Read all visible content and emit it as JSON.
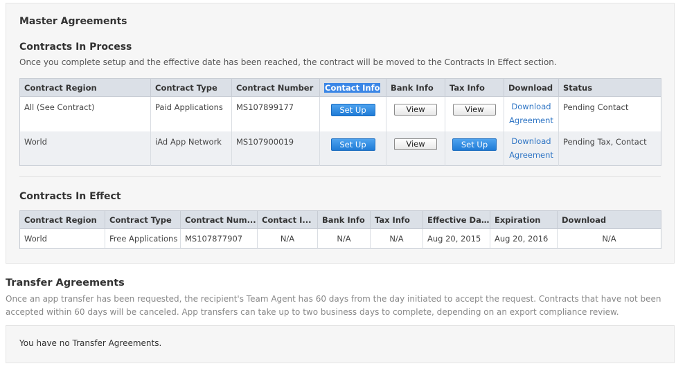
{
  "master": {
    "title": "Master Agreements",
    "in_process": {
      "title": "Contracts In Process",
      "description": "Once you complete setup and the effective date has been reached, the contract will be moved to the Contracts In Effect section.",
      "columns": [
        "Contract Region",
        "Contract Type",
        "Contract Number",
        "Contact Info",
        "Bank Info",
        "Tax Info",
        "Download",
        "Status"
      ],
      "rows": [
        {
          "region": "All (See Contract)",
          "type": "Paid Applications",
          "number": "MS107899177",
          "contact": "Set Up",
          "bank": "View",
          "tax": "View",
          "download_1": "Download",
          "download_2": "Agreement",
          "status": "Pending Contact"
        },
        {
          "region": "World",
          "type": "iAd App Network",
          "number": "MS107900019",
          "contact": "Set Up",
          "bank": "View",
          "tax": "Set Up",
          "download_1": "Download",
          "download_2": "Agreement",
          "status": "Pending Tax, Contact"
        }
      ]
    },
    "in_effect": {
      "title": "Contracts In Effect",
      "columns": [
        "Contract Region",
        "Contract Type",
        "Contract Num...",
        "Contact I...",
        "Bank Info",
        "Tax Info",
        "Effective Date",
        "Expiration",
        "Download"
      ],
      "rows": [
        {
          "region": "World",
          "type": "Free Applications",
          "number": "MS107877907",
          "contact": "N/A",
          "bank": "N/A",
          "tax": "N/A",
          "effective": "Aug 20, 2015",
          "expiration": "Aug 20, 2016",
          "download": "N/A"
        }
      ]
    }
  },
  "transfer": {
    "title": "Transfer Agreements",
    "description_line1": "Once an app transfer has been requested, the recipient's Team Agent has 60 days from the day initiated to accept the request. Contracts that have not been",
    "description_line2": "accepted within 60 days will be canceled. App transfers can take up to two business days to complete, depending on an export compliance review.",
    "empty_message": "You have no Transfer Agreements."
  },
  "colors": {
    "header_bg": "#dbe0e7",
    "link": "#2d74c4",
    "button_blue": "#1f7bd6",
    "selection": "#3a86e6"
  }
}
